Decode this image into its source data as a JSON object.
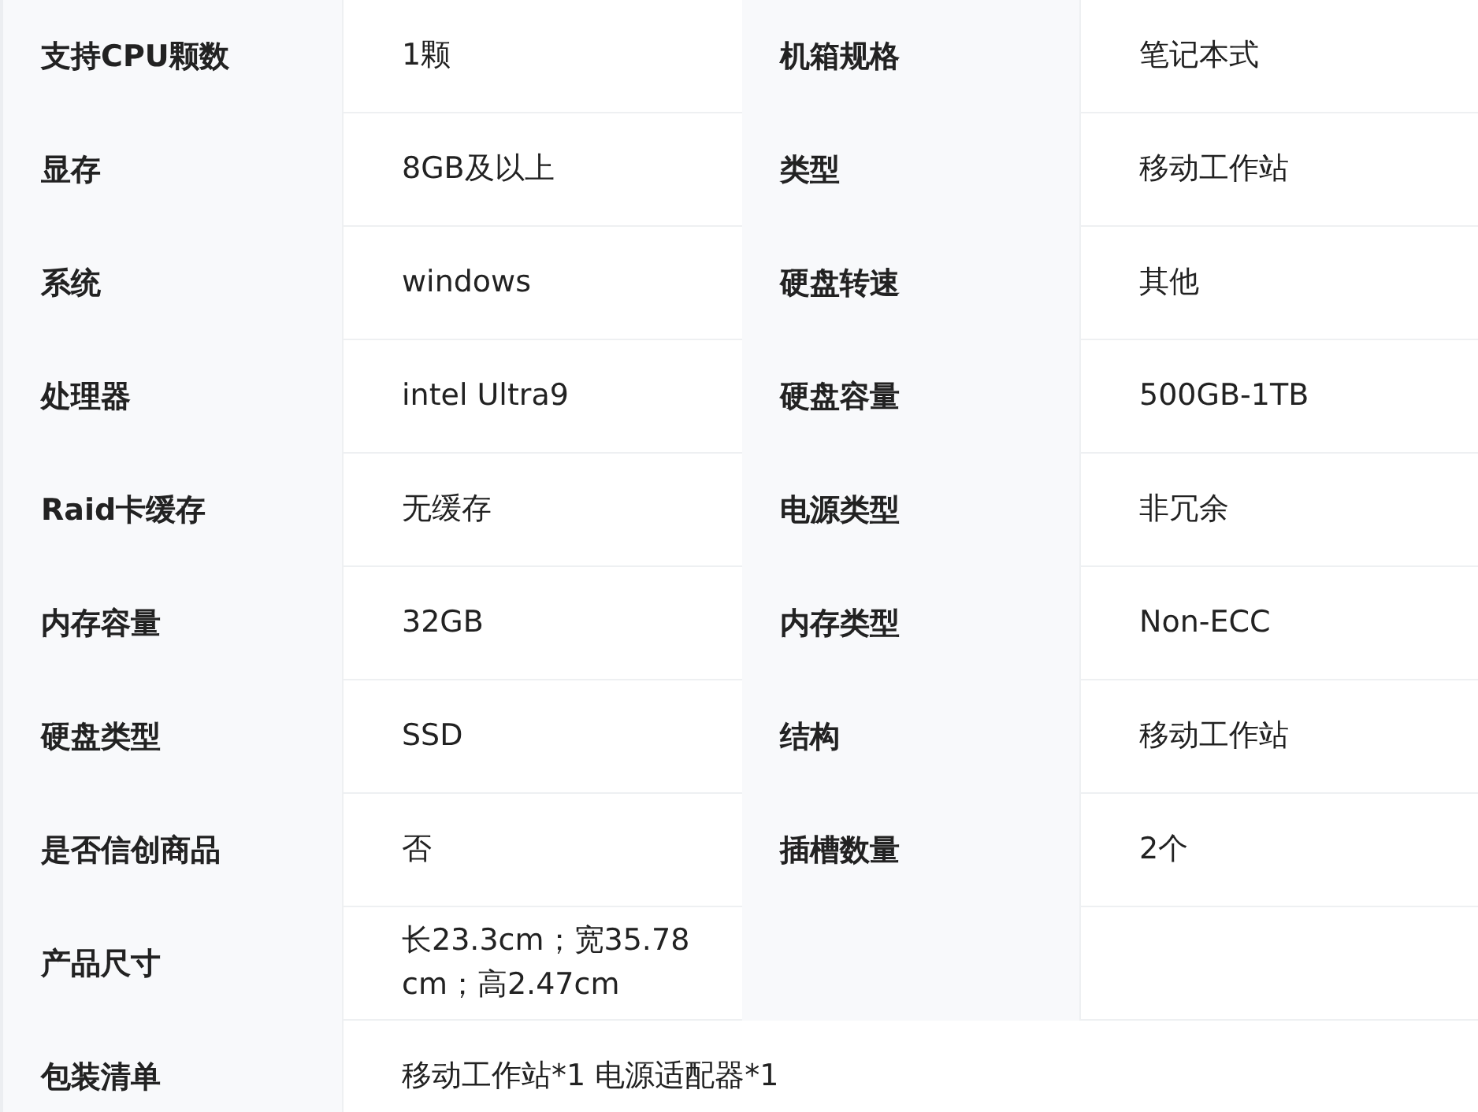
{
  "spec_table": {
    "rows": [
      {
        "kind": "pair",
        "items": [
          {
            "label": "支持CPU颗数",
            "value": "1颗"
          },
          {
            "label": "机箱规格",
            "value": "笔记本式"
          }
        ]
      },
      {
        "kind": "pair",
        "items": [
          {
            "label": "显存",
            "value": "8GB及以上"
          },
          {
            "label": "类型",
            "value": "移动工作站"
          }
        ]
      },
      {
        "kind": "pair",
        "items": [
          {
            "label": "系统",
            "value": "windows"
          },
          {
            "label": "硬盘转速",
            "value": "其他"
          }
        ]
      },
      {
        "kind": "pair",
        "items": [
          {
            "label": "处理器",
            "value": "intel Ultra9"
          },
          {
            "label": "硬盘容量",
            "value": "500GB-1TB"
          }
        ]
      },
      {
        "kind": "pair",
        "items": [
          {
            "label": "Raid卡缓存",
            "value": "无缓存"
          },
          {
            "label": "电源类型",
            "value": "非冗余"
          }
        ]
      },
      {
        "kind": "pair",
        "items": [
          {
            "label": "内存容量",
            "value": "32GB"
          },
          {
            "label": "内存类型",
            "value": "Non-ECC"
          }
        ]
      },
      {
        "kind": "pair",
        "items": [
          {
            "label": "硬盘类型",
            "value": "SSD"
          },
          {
            "label": "结构",
            "value": "移动工作站"
          }
        ]
      },
      {
        "kind": "pair",
        "items": [
          {
            "label": "是否信创商品",
            "value": "否"
          },
          {
            "label": "插槽数量",
            "value": "2个"
          }
        ]
      },
      {
        "kind": "single",
        "items": [
          {
            "label": "产品尺寸",
            "value": "长23.3cm；宽35.78cm；高2.47cm"
          }
        ]
      },
      {
        "kind": "wide",
        "items": [
          {
            "label": "包装清单",
            "value": "移动工作站*1 电源适配器*1"
          }
        ]
      }
    ]
  }
}
